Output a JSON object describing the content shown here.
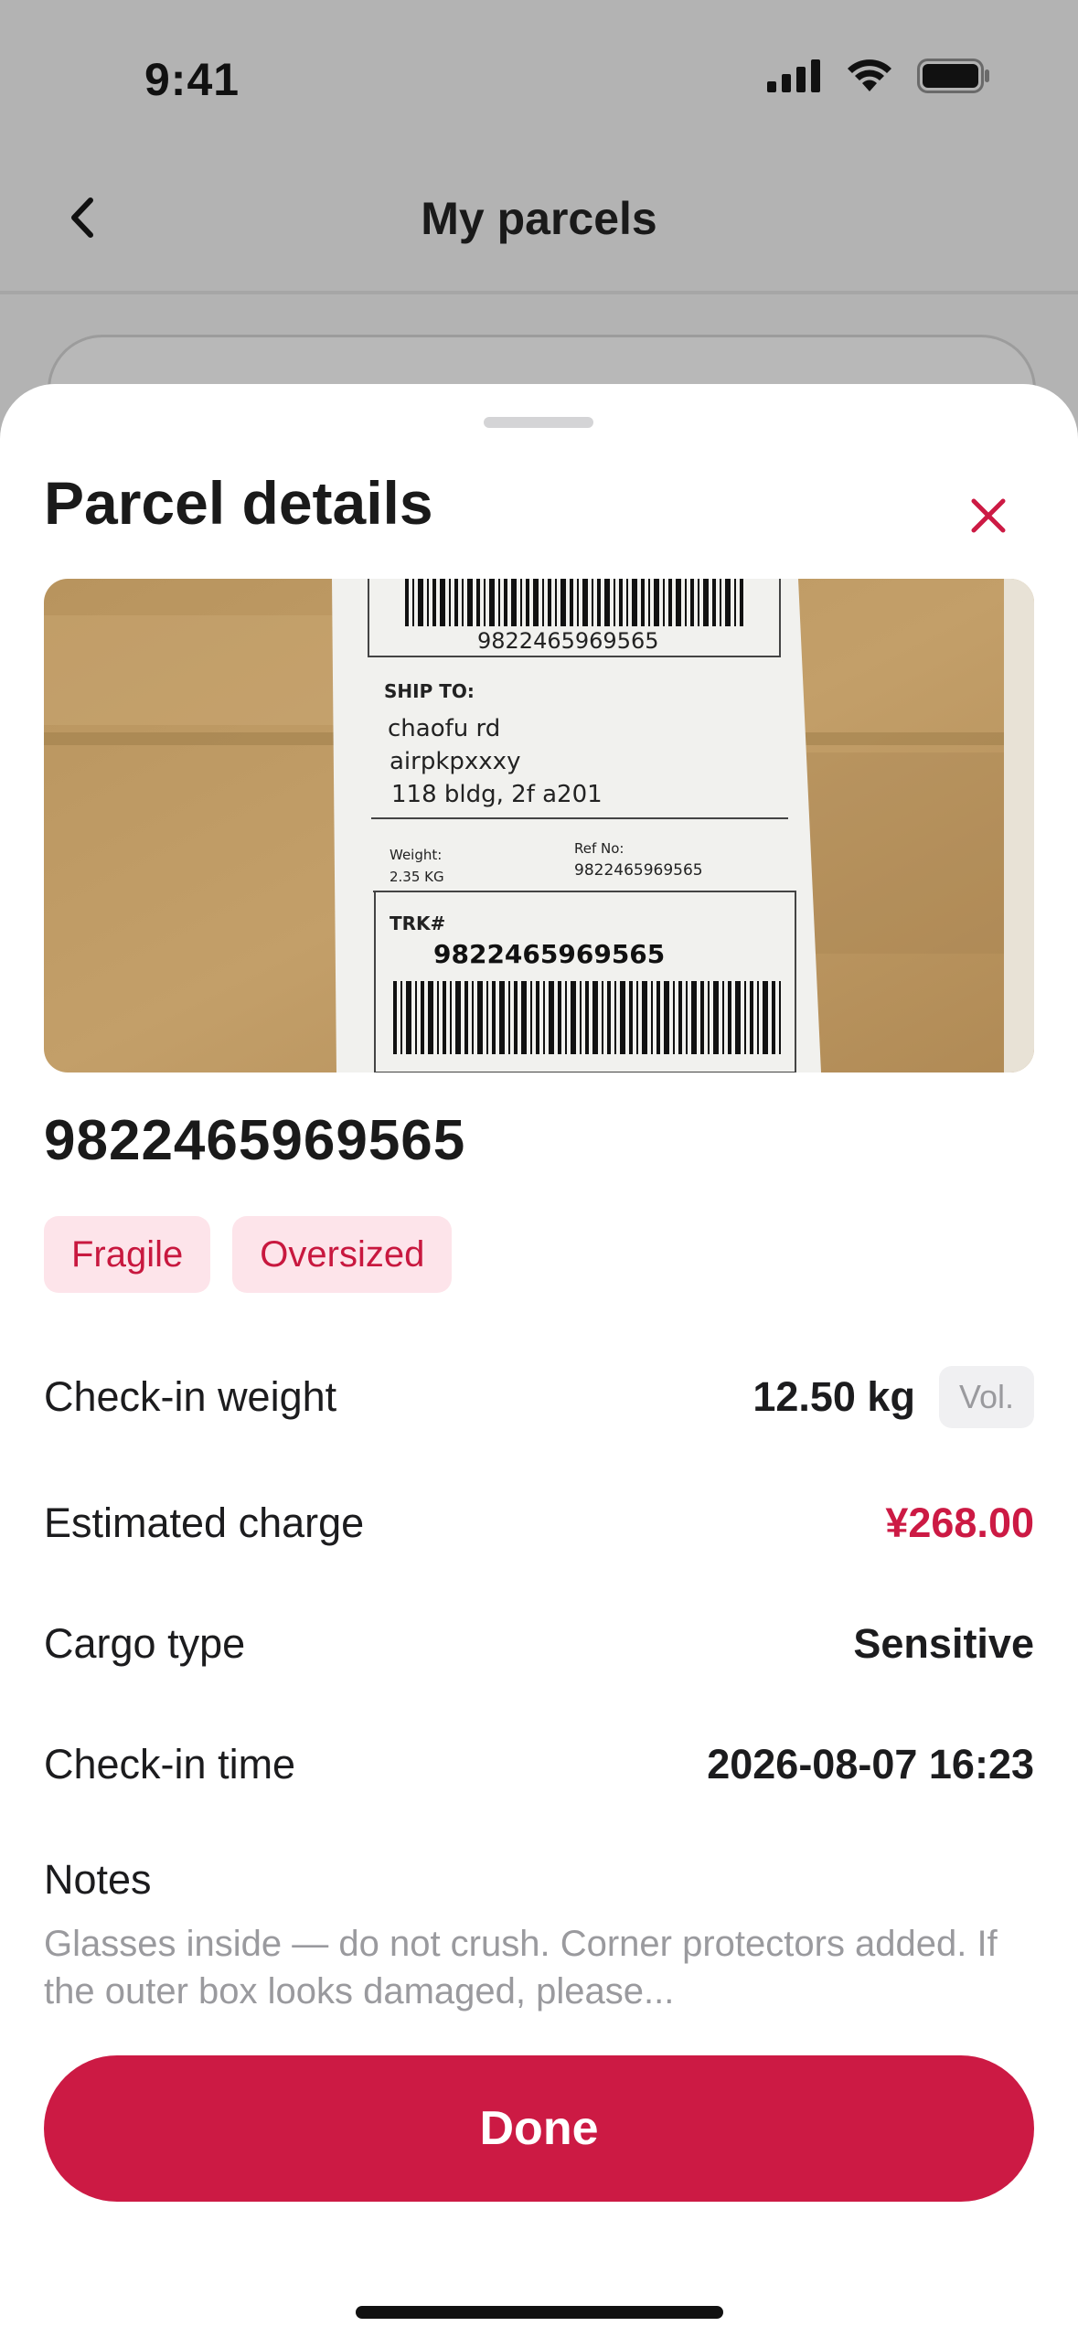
{
  "status_bar": {
    "time": "9:41",
    "icons": [
      "cellular-signal-icon",
      "wifi-icon",
      "battery-icon"
    ]
  },
  "nav": {
    "title": "My parcels",
    "back_icon": "chevron-left-icon"
  },
  "sheet": {
    "title": "Parcel details",
    "close_icon": "close-icon",
    "photo": {
      "barcode_top_number": "9822465969565",
      "ship_to_heading": "SHIP TO:",
      "address_lines": [
        "chaofu rd",
        "airpkpxxxy",
        "118 bldg, 2f a201"
      ],
      "weight_label": "Weight:",
      "weight_value": "2.35 KG",
      "ref_label": "Ref No:",
      "ref_value": "9822465969565",
      "trk_label": "TRK#",
      "trk_value": "9822465969565"
    },
    "tracking_number": "9822465969565",
    "tags": [
      "Fragile",
      "Oversized"
    ],
    "details": {
      "checkin_weight": {
        "label": "Check-in weight",
        "value": "12.50 kg",
        "badge": "Vol."
      },
      "estimated_charge": {
        "label": "Estimated charge",
        "value": "¥268.00"
      },
      "cargo_type": {
        "label": "Cargo type",
        "value": "Sensitive"
      },
      "checkin_time": {
        "label": "Check-in time",
        "value": "2026-08-07 16:23"
      }
    },
    "notes": {
      "label": "Notes",
      "text": "Glasses inside — do not crush. Corner protectors added. If the outer box looks damaged, please..."
    },
    "done_label": "Done"
  },
  "colors": {
    "accent": "#cc1a44",
    "tag_background": "#fde4ea",
    "backdrop": "#b3b3b3"
  }
}
